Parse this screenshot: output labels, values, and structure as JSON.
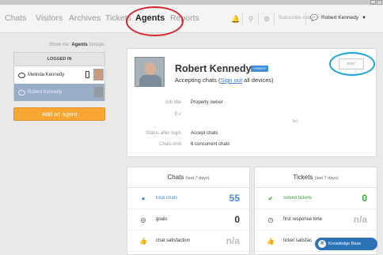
{
  "nav": {
    "items": [
      "Chats",
      "Visitors",
      "Archives",
      "Tickets",
      "Agents",
      "Reports"
    ],
    "subscribe": "Subscribe now",
    "user": "Robert Kennedy"
  },
  "left": {
    "show_me": "Show me:",
    "agents": "Agents",
    "groups": "Groups",
    "header": "LOGGED IN",
    "agents_list": [
      "Melinda Kennedy",
      "Robert Kennedy"
    ],
    "add_button": "Add an agent"
  },
  "profile": {
    "name": "Robert Kennedy",
    "badge": "OWNER",
    "status_prefix": "Accepting chats (",
    "sign_out": "Sign out",
    "status_suffix": " all devices)",
    "edit": "EDIT",
    "job_title_label": "Job title",
    "job_title": "Property owner",
    "email_label": "E-r",
    "email_fragment": "ile)",
    "status_after_login_label": "Status after login",
    "status_after_login": "Accept chats",
    "chats_limit_label": "Chats limit",
    "chats_limit": "6 concurrent chats"
  },
  "chats_card": {
    "title": "Chats",
    "period": "(last 7 days)",
    "rows": [
      {
        "label": "total chats",
        "value": "55"
      },
      {
        "label": "goals",
        "value": "0"
      },
      {
        "label": "chat satisfaction",
        "value": "n/a"
      }
    ]
  },
  "tickets_card": {
    "title": "Tickets",
    "period": "(last 7 days)",
    "rows": [
      {
        "label": "solved tickets",
        "value": "0"
      },
      {
        "label": "first response time",
        "value": "n/a"
      },
      {
        "label": "ticket satisfac",
        "value": ""
      }
    ]
  },
  "kb": "Knowledge Base",
  "colors": {
    "accent_orange": "#f7a533",
    "blue": "#3f8fdd",
    "green": "#3aa03a",
    "red_circle": "#d4242c",
    "blue_circle": "#19a3e0"
  }
}
